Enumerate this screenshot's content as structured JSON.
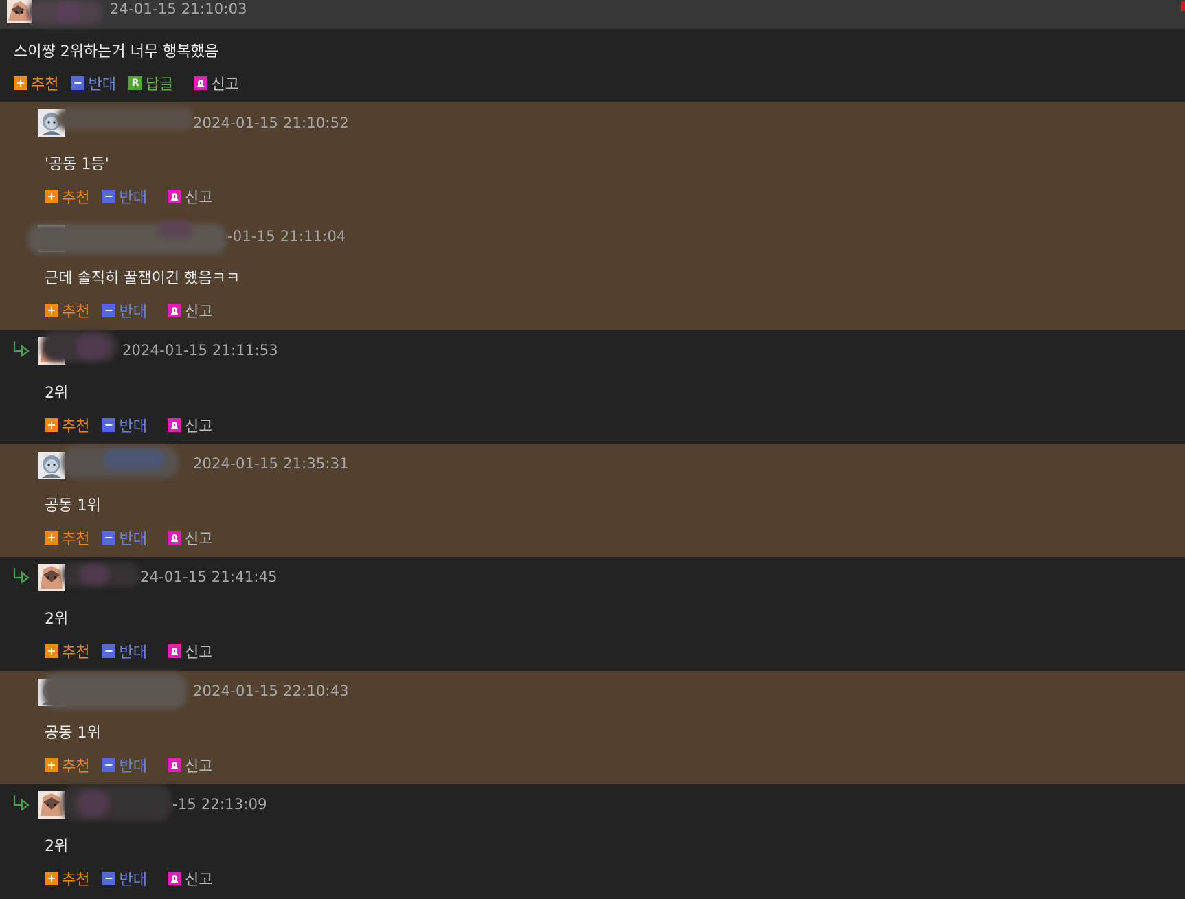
{
  "actions": {
    "recommend": "추천",
    "oppose": "반대",
    "reply": "답글",
    "report": "신고"
  },
  "icons": {
    "recommend": "plus-icon",
    "oppose": "minus-icon",
    "reply": "reply-r-icon",
    "report": "siren-icon",
    "nested": "reply-arrow-icon"
  },
  "colors": {
    "recommend": "#f28a0c",
    "oppose": "#6a82dc",
    "reply": "#5eb83a",
    "report_badge": "#e01fb8",
    "highlight_row": "#52412e",
    "dark_row": "#232323"
  },
  "comments": [
    {
      "timestamp": "24-01-15 21:10:03",
      "text": "스이쨩 2위하는거 너무 행복했음"
    },
    {
      "timestamp": "2024-01-15 21:10:52",
      "text": "'공동 1등'"
    },
    {
      "timestamp": "-01-15 21:11:04",
      "text": "근데 솔직히 꿀잼이긴 했음ㅋㅋ"
    },
    {
      "timestamp": "2024-01-15 21:11:53",
      "text": "2위"
    },
    {
      "timestamp": "2024-01-15 21:35:31",
      "text": "공동 1위"
    },
    {
      "timestamp": "24-01-15 21:41:45",
      "text": "2위"
    },
    {
      "timestamp": "2024-01-15 22:10:43",
      "text": "공동 1위"
    },
    {
      "timestamp": "-15 22:13:09",
      "text": "2위"
    }
  ]
}
